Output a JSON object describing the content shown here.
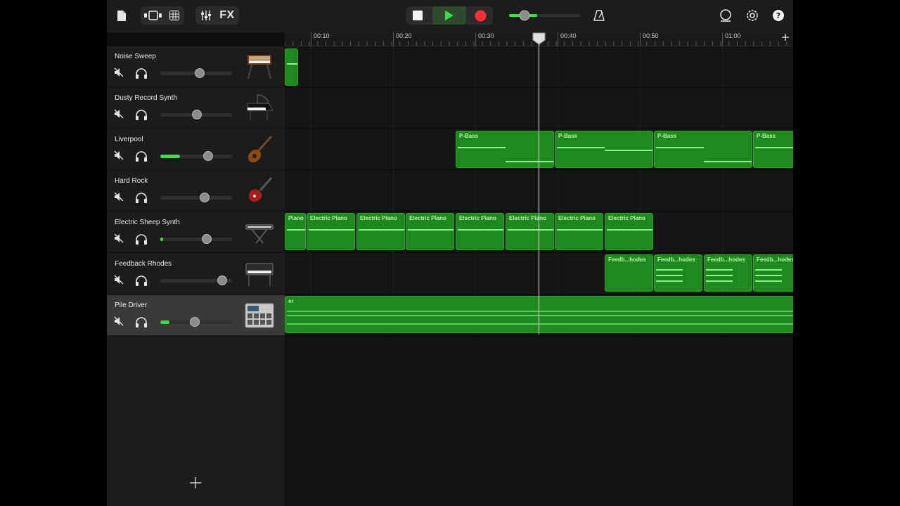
{
  "toolbar": {
    "icons": [
      "document-icon",
      "loop-browser-icon",
      "grid-icon",
      "mixer-icon",
      "stop-icon",
      "play-icon",
      "record-icon",
      "metronome-icon",
      "loop-icon",
      "settings-icon",
      "help-icon"
    ],
    "fx_label": "FX",
    "colors": {
      "play": "#3fdc4a",
      "record": "#ff2d3a"
    }
  },
  "ruler": {
    "labels": [
      "00:10",
      "00:20",
      "00:30",
      "00:40",
      "00:50",
      "01:00"
    ]
  },
  "tracks": [
    {
      "name": "Noise Sweep",
      "volume": 0.55,
      "meter": 0,
      "instrument": "synth-keyboard-icon"
    },
    {
      "name": "Dusty Record Synth",
      "volume": 0.51,
      "meter": 0,
      "instrument": "grand-piano-icon"
    },
    {
      "name": "Liverpool",
      "volume": 0.67,
      "meter": 0.27,
      "instrument": "bass-guitar-icon"
    },
    {
      "name": "Hard Rock",
      "volume": 0.62,
      "meter": 0,
      "instrument": "electric-guitar-icon"
    },
    {
      "name": "Electric Sheep Synth",
      "volume": 0.65,
      "meter": 0.04,
      "instrument": "synth-stand-icon"
    },
    {
      "name": "Feedback Rhodes",
      "volume": 0.86,
      "meter": 0,
      "instrument": "electric-piano-icon"
    },
    {
      "name": "Pile Driver",
      "volume": 0.48,
      "meter": 0.13,
      "instrument": "drum-machine-icon",
      "selected": true
    }
  ],
  "regions": {
    "bass_label": "P-Bass",
    "epiano_label": "Electric Piano",
    "epiano_first_label": "Piano",
    "rhodes_label": "Feedb...hodes",
    "drums_label": "er"
  }
}
